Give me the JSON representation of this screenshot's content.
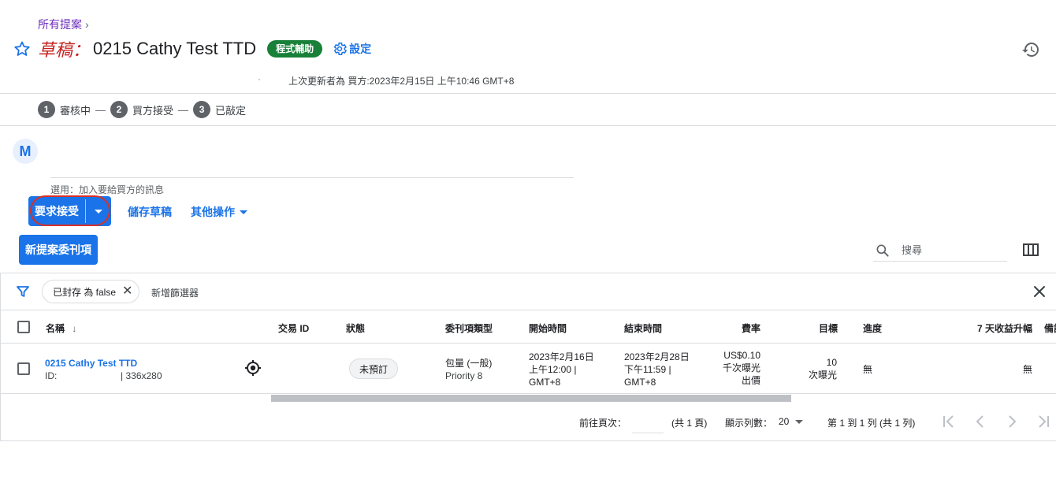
{
  "breadcrumb": {
    "label": "所有提案",
    "chevron": "chevron-right-icon"
  },
  "header": {
    "draft_label": "草稿：",
    "title": "0215 Cathy Test TTD",
    "badge": "程式輔助",
    "settings_label": "設定",
    "last_updated": "上次更新者為 買方:2023年2月15日 上午10:46 GMT+8"
  },
  "stepper": [
    {
      "num": "1",
      "label": "審核中"
    },
    {
      "num": "2",
      "label": "買方接受"
    },
    {
      "num": "3",
      "label": "已敲定"
    }
  ],
  "stepper_sep": "—",
  "message": {
    "avatar": "M",
    "hint": "選用：加入要給買方的訊息"
  },
  "actions": {
    "request_accept": "要求接受",
    "save_draft": "儲存草稿",
    "more_actions": "其他操作",
    "new_line_item": "新提案委刊項"
  },
  "search": {
    "placeholder": "搜尋"
  },
  "filters": {
    "chip_label": "已封存 為 false",
    "add_filter": "新增篩選器"
  },
  "table": {
    "columns": {
      "name": "名稱",
      "deal_id": "交易 ID",
      "status": "狀態",
      "line_item_type": "委刊項類型",
      "start_time": "開始時間",
      "end_time": "結束時間",
      "rate": "費率",
      "goal": "目標",
      "progress": "進度",
      "revenue_lift": "7 天收益升幅",
      "notes": "備註"
    },
    "rows": [
      {
        "name": "0215 Cathy Test TTD",
        "id_prefix": "ID:",
        "size": "| 336x280",
        "status": "未預訂",
        "type_line1": "包量 (一般)",
        "type_line2": "Priority 8",
        "start_line1": "2023年2月16日",
        "start_line2": "上午12:00 |",
        "start_line3": "GMT+8",
        "end_line1": "2023年2月28日",
        "end_line2": "下午11:59 |",
        "end_line3": "GMT+8",
        "rate_line1": "US$0.10",
        "rate_line2": "千次曝光",
        "rate_line3": "出價",
        "goal_line1": "10",
        "goal_line2": "次曝光",
        "progress": "無",
        "revenue_lift": "無"
      }
    ]
  },
  "pagination": {
    "goto_label": "前往頁次：",
    "total_pages": "(共 1 頁)",
    "rows_label": "顯示列數：",
    "rows_value": "20",
    "range": "第 1 到 1 列 (共 1 列)"
  },
  "colors": {
    "primary": "#1a73e8",
    "draft_red": "#c5221f",
    "badge_green": "#188038",
    "breadcrumb_purple": "#6c2dbb",
    "highlight_ring": "#d93025"
  }
}
